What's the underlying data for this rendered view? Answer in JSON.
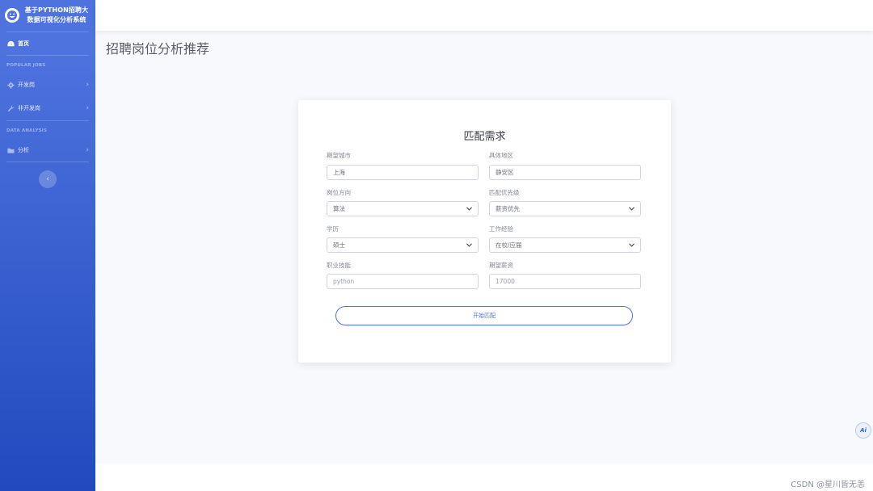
{
  "sidebar": {
    "brand": "基于PYTHON招聘大数据可视化分析系统",
    "home_label": "首页",
    "section_popular": "POPULAR JOBS",
    "item_dev": "开发岗",
    "item_nondev": "非开发岗",
    "section_analysis": "DATA ANALYSIS",
    "item_analysis": "分析",
    "chevron": "›",
    "toggle": "‹"
  },
  "header": {
    "page_title": "招聘岗位分析推荐"
  },
  "form": {
    "title": "匹配需求",
    "city_label": "期望城市",
    "city_value": "上海",
    "district_label": "具体地区",
    "district_value": "静安区",
    "direction_label": "岗位方向",
    "direction_value": "算法",
    "priority_label": "匹配优先级",
    "priority_value": "薪资优先",
    "education_label": "学历",
    "education_value": "硕士",
    "experience_label": "工作经验",
    "experience_value": "在校/应届",
    "skills_label": "职业技能",
    "skills_placeholder": "python",
    "salary_label": "期望薪资",
    "salary_placeholder": "17000",
    "submit_label": "开始匹配"
  },
  "watermark": "CSDN @星川皆无恙",
  "ai_badge": "Ai",
  "colors": {
    "sidebar_top": "#4e73df",
    "sidebar_bottom": "#224abe",
    "accent": "#4e73df"
  }
}
